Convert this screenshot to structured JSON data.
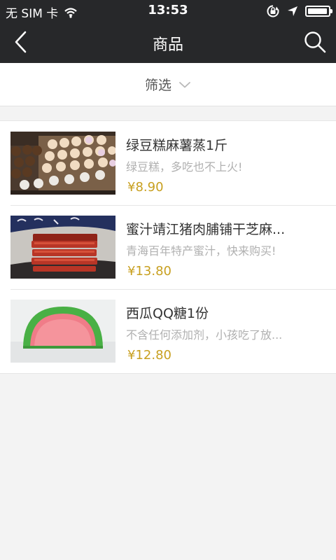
{
  "status_bar": {
    "carrier": "无 SIM 卡",
    "time": "13:53",
    "icons": [
      "wifi-icon",
      "orientation-lock-icon",
      "location-arrow-icon",
      "battery-icon"
    ],
    "battery_level": 0.95
  },
  "nav": {
    "title": "商品",
    "back_icon": "chevron-left-icon",
    "search_icon": "search-icon"
  },
  "filter": {
    "label": "筛选",
    "icon": "chevron-down-icon"
  },
  "products": [
    {
      "title": "绿豆糕麻薯蒸1斤",
      "desc": "绿豆糕，多吃也不上火!",
      "price": "¥8.90"
    },
    {
      "title": "蜜汁靖江猪肉脯铺干芝麻...",
      "desc": "青海百年特产蜜汁，快来购买!",
      "price": "¥13.80"
    },
    {
      "title": "西瓜QQ糖1份",
      "desc": "不含任何添加剂，小孩吃了放...",
      "price": "¥12.80"
    }
  ],
  "colors": {
    "bar_bg": "#27282a",
    "price": "#c8a020",
    "page_bg": "#f3f3f3"
  }
}
